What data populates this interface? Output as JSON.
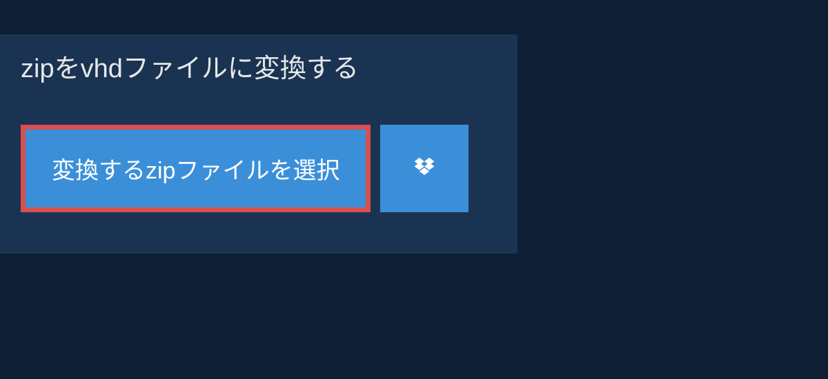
{
  "header": {
    "title": "zipをvhdファイルに変換する"
  },
  "buttons": {
    "select_file_label": "変換するzipファイルを選択"
  },
  "colors": {
    "background": "#0f1f33",
    "panel": "#1a3352",
    "button_primary": "#3b8fd9",
    "button_highlight_border": "#d94f4f",
    "text_light": "#e8e8e8",
    "text_white": "#ffffff"
  }
}
